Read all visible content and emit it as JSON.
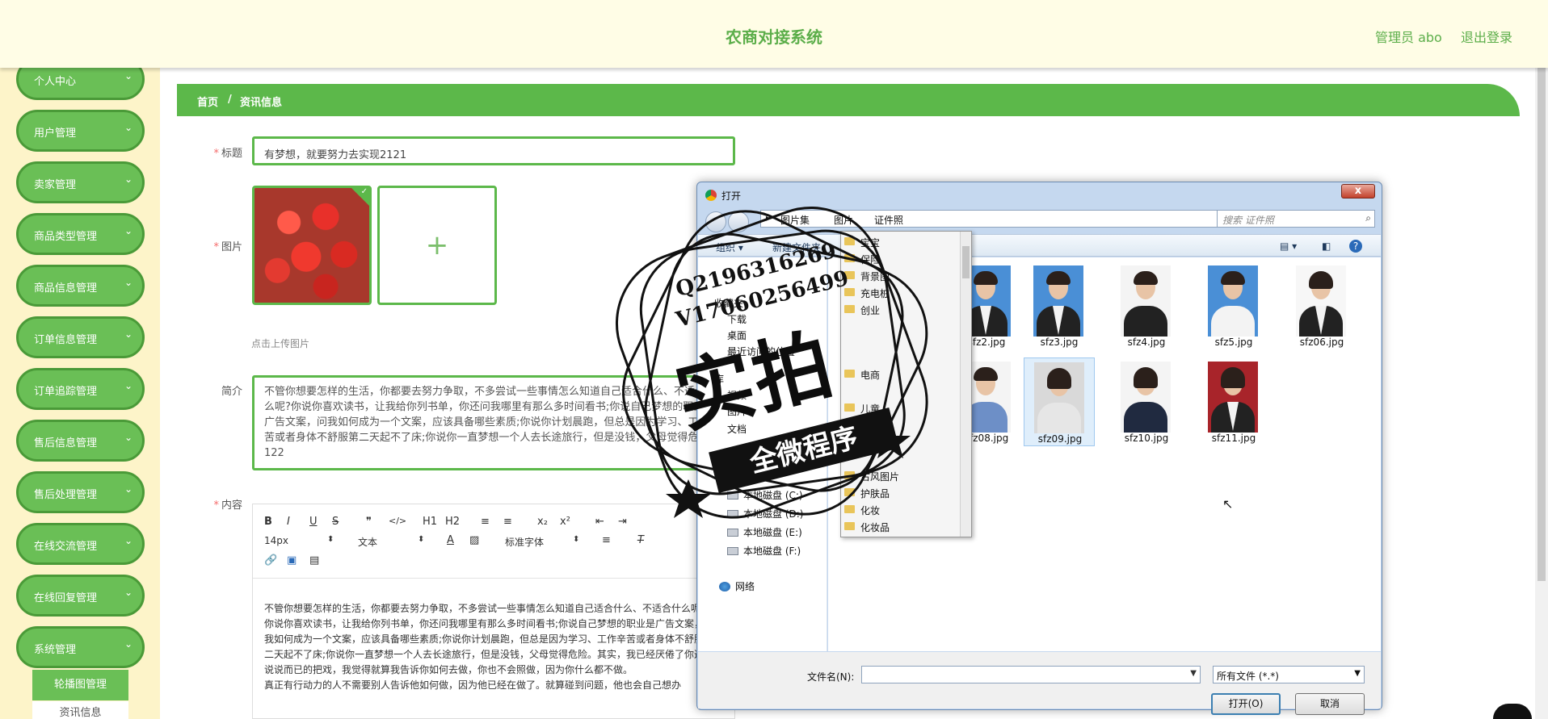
{
  "header": {
    "title": "农商对接系统",
    "admin": "管理员 abo",
    "logout": "退出登录"
  },
  "sidebar": {
    "items": [
      {
        "label": "个人中心"
      },
      {
        "label": "用户管理"
      },
      {
        "label": "卖家管理"
      },
      {
        "label": "商品类型管理"
      },
      {
        "label": "商品信息管理"
      },
      {
        "label": "订单信息管理"
      },
      {
        "label": "订单追踪管理"
      },
      {
        "label": "售后信息管理"
      },
      {
        "label": "售后处理管理"
      },
      {
        "label": "在线交流管理"
      },
      {
        "label": "在线回复管理"
      },
      {
        "label": "系统管理"
      }
    ],
    "sub_items": [
      {
        "label": "轮播图管理"
      },
      {
        "label": "资讯信息"
      }
    ]
  },
  "breadcrumb": {
    "home": "首页",
    "sep": "/",
    "current": "资讯信息"
  },
  "form": {
    "title_label": "标题",
    "title_value": "有梦想，就要努力去实现2121",
    "image_label": "图片",
    "add_glyph": "+",
    "upload_tip": "点击上传图片",
    "intro_label": "简介",
    "intro_value": "不管你想要怎样的生活，你都要去努力争取，不多尝试一些事情怎么知道自己适合什么、不适合什么呢?你说你喜欢读书，让我给你列书单，你还问我哪里有那么多时间看书;你说自己梦想的职业是广告文案，问我如何成为一个文案，应该具备哪些素质;你说你计划晨跑，但总是因为学习、工作辛苦或者身体不舒服第二天起不了床;你说你一直梦想一个人去长途旅行，但是没钱，父母觉得危险。122",
    "content_label": "内容",
    "required_mark": "*"
  },
  "editor": {
    "toolbar_row1": [
      "B",
      "I",
      "U",
      "S",
      "❞",
      "</>",
      "H1",
      "H2",
      "≡",
      "≡",
      "x₂",
      "x²",
      "⇤",
      "⇥"
    ],
    "font_size": "14px",
    "text_style": "文本",
    "font_family": "标准字体",
    "content": [
      "不管你想要怎样的生活，你都要去努力争取，不多尝试一些事情怎么知道自己适合什么、不适合什么呢?",
      "你说你喜欢读书，让我给你列书单，你还问我哪里有那么多时间看书;你说自己梦想的职业是广告文案，问我如何成为一个文案，应该具备哪些素质;你说你计划晨跑，但总是因为学习、工作辛苦或者身体不舒服第二天起不了床;你说你一直梦想一个人去长途旅行，但是没钱，父母觉得危险。其实，我已经厌倦了你这样说说而已的把戏，我觉得就算我告诉你如何去做，你也不会照做，因为你什么都不做。",
      "真正有行动力的人不需要别人告诉他如何做，因为他已经在做了。就算碰到问题，他也会自己想办"
    ]
  },
  "dialog": {
    "title": "打开",
    "close": "x",
    "address": [
      "图片集",
      "图片",
      "证件照"
    ],
    "search_placeholder": "搜索 证件照",
    "cmd_organize": "组织 ▾",
    "cmd_newfolder": "新建文件夹",
    "nav": [
      {
        "label": "收藏夹"
      },
      {
        "label": "下载"
      },
      {
        "label": "桌面"
      },
      {
        "label": "最近访问的位置"
      },
      {
        "label": "库"
      },
      {
        "label": "视频"
      },
      {
        "label": "图片"
      },
      {
        "label": "文档"
      },
      {
        "label": "本地磁盘 (C:)"
      },
      {
        "label": "本地磁盘 (D:)"
      },
      {
        "label": "本地磁盘 (E:)"
      },
      {
        "label": "本地磁盘 (F:)"
      },
      {
        "label": "网络"
      }
    ],
    "files": [
      {
        "name": "sfz2.jpg"
      },
      {
        "name": "sfz3.jpg"
      },
      {
        "name": "sfz4.jpg"
      },
      {
        "name": "sfz5.jpg"
      },
      {
        "name": "sfz06.jpg"
      },
      {
        "name": "sfz08.jpg"
      },
      {
        "name": "sfz09.jpg"
      },
      {
        "name": "sfz10.jpg"
      },
      {
        "name": "sfz11.jpg"
      }
    ],
    "filename_label": "文件名(N):",
    "filetype": "所有文件 (*.*)",
    "open_button": "打开(O)",
    "cancel_button": "取消"
  },
  "folder_menu": [
    {
      "label": "宝宝"
    },
    {
      "label": "保险"
    },
    {
      "label": "背景图"
    },
    {
      "label": "充电桩"
    },
    {
      "label": "创业"
    },
    {
      "label": "电商"
    },
    {
      "label": "儿童"
    },
    {
      "label": "古风图片"
    },
    {
      "label": "护肤品"
    },
    {
      "label": "化妆"
    },
    {
      "label": "化妆品"
    }
  ],
  "watermark": {
    "line1": "Q2196316269",
    "line2": "V17060256499",
    "big": "实拍",
    "ribbon": "全微程序"
  },
  "colors": {
    "accent": "#5cb84a",
    "header_bg": "#fffde6",
    "sidebar_bg": "#fdf4c9"
  }
}
